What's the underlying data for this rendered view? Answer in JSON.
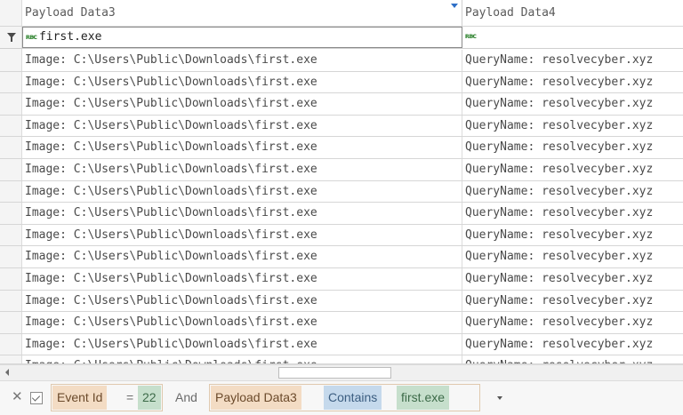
{
  "grid": {
    "columns": [
      {
        "label": "Payload Data3"
      },
      {
        "label": "Payload Data4"
      }
    ],
    "filter_row": {
      "col1_value": "first.exe",
      "col2_value": ""
    },
    "rows": [
      {
        "col1": "Image: C:\\Users\\Public\\Downloads\\first.exe",
        "col2": "QueryName: resolvecyber.xyz"
      },
      {
        "col1": "Image: C:\\Users\\Public\\Downloads\\first.exe",
        "col2": "QueryName: resolvecyber.xyz"
      },
      {
        "col1": "Image: C:\\Users\\Public\\Downloads\\first.exe",
        "col2": "QueryName: resolvecyber.xyz"
      },
      {
        "col1": "Image: C:\\Users\\Public\\Downloads\\first.exe",
        "col2": "QueryName: resolvecyber.xyz"
      },
      {
        "col1": "Image: C:\\Users\\Public\\Downloads\\first.exe",
        "col2": "QueryName: resolvecyber.xyz"
      },
      {
        "col1": "Image: C:\\Users\\Public\\Downloads\\first.exe",
        "col2": "QueryName: resolvecyber.xyz"
      },
      {
        "col1": "Image: C:\\Users\\Public\\Downloads\\first.exe",
        "col2": "QueryName: resolvecyber.xyz"
      },
      {
        "col1": "Image: C:\\Users\\Public\\Downloads\\first.exe",
        "col2": "QueryName: resolvecyber.xyz"
      },
      {
        "col1": "Image: C:\\Users\\Public\\Downloads\\first.exe",
        "col2": "QueryName: resolvecyber.xyz"
      },
      {
        "col1": "Image: C:\\Users\\Public\\Downloads\\first.exe",
        "col2": "QueryName: resolvecyber.xyz"
      },
      {
        "col1": "Image: C:\\Users\\Public\\Downloads\\first.exe",
        "col2": "QueryName: resolvecyber.xyz"
      },
      {
        "col1": "Image: C:\\Users\\Public\\Downloads\\first.exe",
        "col2": "QueryName: resolvecyber.xyz"
      },
      {
        "col1": "Image: C:\\Users\\Public\\Downloads\\first.exe",
        "col2": "QueryName: resolvecyber.xyz"
      },
      {
        "col1": "Image: C:\\Users\\Public\\Downloads\\first.exe",
        "col2": "QueryName: resolvecyber.xyz"
      },
      {
        "col1": "Image: C:\\Users\\Public\\Downloads\\first.exe",
        "col2": "QueryName: resolvecyber.xyz"
      }
    ]
  },
  "filter_bar": {
    "close_icon": "close-icon",
    "enabled": true,
    "clause1": {
      "field": "Event Id",
      "operator": "=",
      "value": "22"
    },
    "joiner": "And",
    "clause2": {
      "field": "Payload Data3",
      "condition": "Contains",
      "value": "first.exe"
    }
  },
  "icons": {
    "filter_row": "funnel-icon",
    "filter_operator": "rbc-condition-icon",
    "scroll_left": "chevron-left-icon",
    "dropdown": "chevron-down-icon"
  },
  "colors": {
    "field_token": "#f3dcc4",
    "value_token": "#c6dfcc",
    "condition_token": "#c5d9ec",
    "sort_marker": "#2e6fc7"
  }
}
